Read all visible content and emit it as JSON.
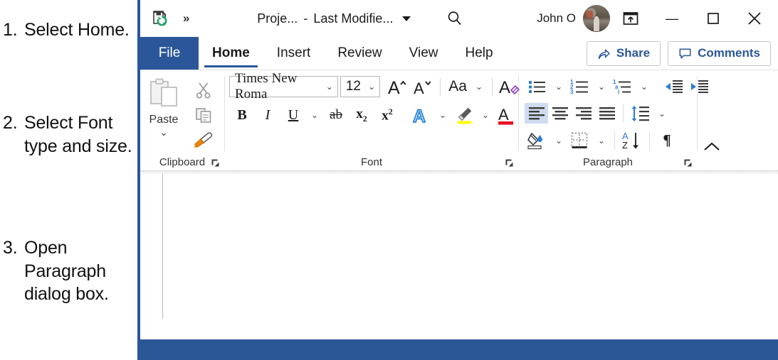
{
  "instructions": {
    "steps": [
      {
        "num": "1.",
        "text": "Select Home."
      },
      {
        "num": "2.",
        "text": "Select Font type and size."
      },
      {
        "num": "3.",
        "text": "Open Paragraph dialog box."
      }
    ]
  },
  "titlebar": {
    "autosave_icon": "save-sync-icon",
    "overflow_chevrons": "»",
    "document_name": "Proje...",
    "separator": "-",
    "modified_label": "Last Modifie...",
    "search_icon": "search-icon",
    "user_name": "John O",
    "avatar": "user-avatar",
    "ribbon_display_icon": "ribbon-display-options-icon",
    "minimize": "—",
    "maximize": "□",
    "close": "×"
  },
  "tabs": {
    "file": "File",
    "items": [
      {
        "label": "Home",
        "active": true
      },
      {
        "label": "Insert",
        "active": false
      },
      {
        "label": "Review",
        "active": false
      },
      {
        "label": "View",
        "active": false
      },
      {
        "label": "Help",
        "active": false
      }
    ],
    "share": "Share",
    "comments": "Comments"
  },
  "ribbon": {
    "clipboard": {
      "group_label": "Clipboard",
      "paste_label": "Paste",
      "paste_icon": "paste-icon",
      "cut_icon": "cut-scissors-icon",
      "copy_icon": "copy-icon",
      "format_painter_icon": "format-painter-icon",
      "launcher_icon": "dialog-launcher-icon"
    },
    "font": {
      "group_label": "Font",
      "font_name": "Times New Roma",
      "font_size": "12",
      "grow_font_icon": "grow-font-icon",
      "shrink_font_icon": "shrink-font-icon",
      "change_case_label": "Aa",
      "clear_formatting_icon": "clear-formatting-icon",
      "bold": "B",
      "italic": "I",
      "underline": "U",
      "strikethrough": "ab",
      "subscript": "x",
      "subscript_index": "2",
      "superscript": "x",
      "superscript_index": "2",
      "text_effects_icon": "text-effects-icon",
      "highlight_icon": "text-highlight-icon",
      "font_color_icon": "font-color-icon",
      "highlight_color": "#FFFF00",
      "font_color": "#E81123",
      "launcher_icon": "dialog-launcher-icon"
    },
    "paragraph": {
      "group_label": "Paragraph",
      "bullets_icon": "bullet-list-icon",
      "numbering_icon": "numbered-list-icon",
      "multilevel_icon": "multilevel-list-icon",
      "decrease_indent_icon": "decrease-indent-icon",
      "increase_indent_icon": "increase-indent-icon",
      "align_left_icon": "align-left-icon",
      "align_center_icon": "align-center-icon",
      "align_right_icon": "align-right-icon",
      "justify_icon": "justify-icon",
      "line_spacing_icon": "line-spacing-icon",
      "shading_icon": "shading-icon",
      "borders_icon": "borders-icon",
      "sort_icon": "sort-az-icon",
      "show_marks_label": "¶",
      "launcher_icon": "dialog-launcher-icon",
      "active_alignment": "align-left"
    },
    "collapse_icon": "collapse-ribbon-icon"
  },
  "colors": {
    "word_blue": "#2B579A",
    "status_blue": "#2B5797",
    "accent_icon_blue": "#2B7CD3",
    "selected_fill": "#CFDCF0"
  }
}
